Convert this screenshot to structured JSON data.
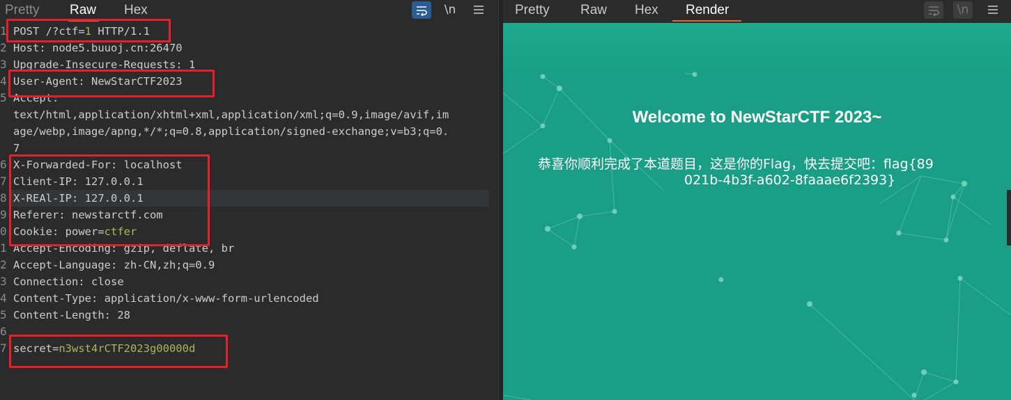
{
  "request": {
    "tabs": [
      {
        "label": "Pretty"
      },
      {
        "label": "Raw"
      },
      {
        "label": "Hex"
      }
    ],
    "active_tab": "Raw",
    "tools": {
      "wrap_icon": "word-wrap-icon",
      "newline_label": "\\n",
      "menu_icon": "hamburger-menu-icon"
    },
    "lines": [
      {
        "n": "1",
        "name": "POST /?ctf=",
        "val": "1",
        "tail": " HTTP/1.1"
      },
      {
        "n": "2",
        "name": "Host:",
        "val": " node5.buuoj.cn:26470"
      },
      {
        "n": "3",
        "name": "Upgrade-Insecure-Requests:",
        "val": " 1"
      },
      {
        "n": "4",
        "name": "User-Agent:",
        "val": " NewStarCTF2023"
      },
      {
        "n": "5",
        "name": "Accept:",
        "val": ""
      },
      {
        "n": "",
        "name": "",
        "val": "text/html,application/xhtml+xml,application/xml;q=0.9,image/avif,im"
      },
      {
        "n": "",
        "name": "",
        "val": "age/webp,image/apng,*/*;q=0.8,application/signed-exchange;v=b3;q=0."
      },
      {
        "n": "",
        "name": "",
        "val": "7"
      },
      {
        "n": "6",
        "name": "X-Forwarded-For:",
        "val": " localhost"
      },
      {
        "n": "7",
        "name": "Client-IP:",
        "val": " 127.0.0.1"
      },
      {
        "n": "8",
        "name": "X-REAl-IP:",
        "val": " 127.0.0.1"
      },
      {
        "n": "9",
        "name": "Referer:",
        "val": " newstarctf.com"
      },
      {
        "n": "0",
        "name": "Cookie:",
        "val": " power=",
        "pval": "ctfer"
      },
      {
        "n": "1",
        "name": "Accept-Encoding:",
        "val": " gzip, deflate, br"
      },
      {
        "n": "2",
        "name": "Accept-Language:",
        "val": " zh-CN,zh;q=0.9"
      },
      {
        "n": "3",
        "name": "Connection:",
        "val": " close"
      },
      {
        "n": "4",
        "name": "Content-Type:",
        "val": " application/x-www-form-urlencoded"
      },
      {
        "n": "5",
        "name": "Content-Length:",
        "val": " 28"
      },
      {
        "n": "6",
        "name": "",
        "val": ""
      },
      {
        "n": "7",
        "name": "secret=",
        "val": "",
        "pval": "n3wst4rCTF2023g00000d"
      }
    ]
  },
  "response": {
    "tabs": [
      {
        "label": "Pretty"
      },
      {
        "label": "Raw"
      },
      {
        "label": "Hex"
      },
      {
        "label": "Render"
      }
    ],
    "active_tab": "Render",
    "tools": {
      "wrap_icon": "word-wrap-icon",
      "newline_label": "\\n",
      "menu_icon": "hamburger-menu-icon"
    },
    "render": {
      "welcome": "Welcome to NewStarCTF 2023~",
      "message_line1": "恭喜你顺利完成了本道题目，这是你的Flag，快去提交吧：flag{89",
      "message_line2": "021b-4b3f-a602-8faaae6f2393}",
      "background_color": "#1a9e85"
    }
  },
  "colors": {
    "highlight_box": "#e8202a",
    "active_tab_underline": "#e8672c",
    "param_value": "#a8b85a"
  }
}
